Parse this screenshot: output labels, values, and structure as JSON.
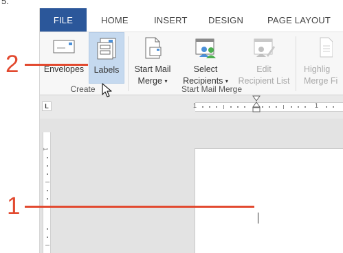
{
  "page_number": "5.",
  "tabs": [
    {
      "label": "FILE"
    },
    {
      "label": "HOME"
    },
    {
      "label": "INSERT"
    },
    {
      "label": "DESIGN"
    },
    {
      "label": "PAGE LAYOUT"
    }
  ],
  "ribbon": {
    "envelopes": {
      "label": "Envelopes"
    },
    "labels": {
      "label": "Labels"
    },
    "start_mail_merge": {
      "line1": "Start Mail",
      "line2": "Merge"
    },
    "select_recipients": {
      "line1": "Select",
      "line2": "Recipients"
    },
    "edit_recipient_list": {
      "line1": "Edit",
      "line2": "Recipient List"
    },
    "highlight_merge_fields": {
      "line1": "Highlig",
      "line2": "Merge Fi"
    },
    "groups": {
      "create": "Create",
      "start_mail_merge": "Start Mail Merge"
    }
  },
  "tab_selector_glyph": "L",
  "ruler": {
    "h_labels": [
      "1",
      "1"
    ],
    "v_label": "1"
  },
  "callouts": {
    "one": "1",
    "two": "2"
  },
  "colors": {
    "file_tab": "#2b579a",
    "callout": "#e2492f",
    "labels_highlight": "#c5d9ef"
  }
}
